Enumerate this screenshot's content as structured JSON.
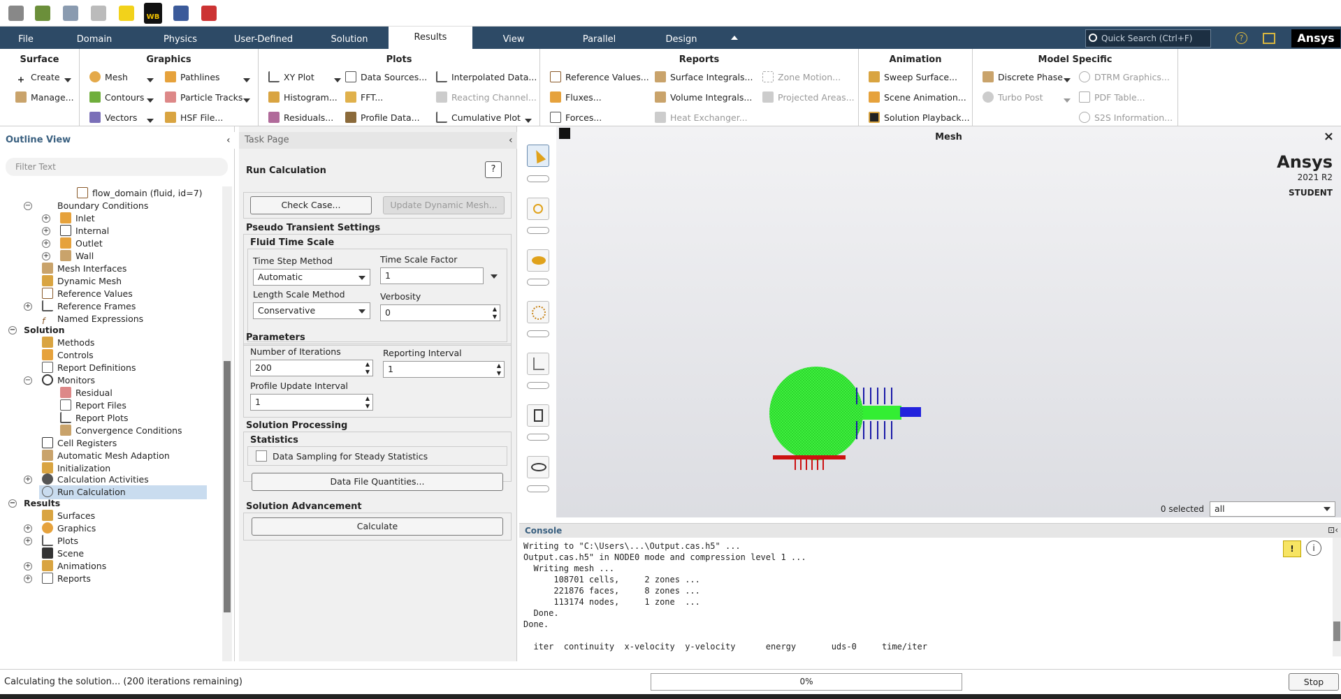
{
  "toolbar_quick_access": [
    "new-file-icon",
    "open-icon",
    "save-icon",
    "reload-icon",
    "power-icon",
    "workbench-icon",
    "parallel-icon",
    "units-icon"
  ],
  "workbench_label": "WB",
  "menu": {
    "tabs": [
      "File",
      "Domain",
      "Physics",
      "User-Defined",
      "Solution",
      "Results",
      "View",
      "Parallel",
      "Design"
    ],
    "active": "Results",
    "search_placeholder": "Quick Search (Ctrl+F)",
    "brand": "Ansys"
  },
  "ribbon": {
    "surface": {
      "title": "Surface",
      "items": [
        "Create",
        "Manage..."
      ]
    },
    "graphics": {
      "title": "Graphics",
      "items": [
        "Mesh",
        "Contours",
        "Vectors",
        "Pathlines",
        "Particle Tracks",
        "HSF File..."
      ]
    },
    "plots": {
      "title": "Plots",
      "items": [
        "XY Plot",
        "Histogram...",
        "Residuals...",
        "Data Sources...",
        "FFT...",
        "Profile Data...",
        "Interpolated Data...",
        "Reacting Channel...",
        "Cumulative Plot"
      ]
    },
    "reports": {
      "title": "Reports",
      "items": [
        "Reference Values...",
        "Fluxes...",
        "Forces...",
        "Surface Integrals...",
        "Volume Integrals...",
        "Heat Exchanger...",
        "Zone Motion...",
        "Projected Areas..."
      ]
    },
    "animation": {
      "title": "Animation",
      "items": [
        "Sweep Surface...",
        "Scene Animation...",
        "Solution Playback..."
      ]
    },
    "model_specific": {
      "title": "Model Specific",
      "items": [
        "Discrete Phase",
        "Turbo Post",
        "DTRM Graphics...",
        "PDF Table...",
        "S2S Information..."
      ]
    }
  },
  "outline": {
    "title": "Outline View",
    "filter_placeholder": "Filter Text",
    "nodes": [
      "flow_domain (fluid, id=7)",
      "Boundary Conditions",
      "Inlet",
      "Internal",
      "Outlet",
      "Wall",
      "Mesh Interfaces",
      "Dynamic Mesh",
      "Reference Values",
      "Reference Frames",
      "Named Expressions",
      "Solution",
      "Methods",
      "Controls",
      "Report Definitions",
      "Monitors",
      "Residual",
      "Report Files",
      "Report Plots",
      "Convergence Conditions",
      "Cell Registers",
      "Automatic Mesh Adaption",
      "Initialization",
      "Calculation Activities",
      "Run Calculation",
      "Results",
      "Surfaces",
      "Graphics",
      "Plots",
      "Scene",
      "Animations",
      "Reports"
    ]
  },
  "task": {
    "title": "Task Page",
    "heading": "Run Calculation",
    "help": "?",
    "check_case": "Check Case...",
    "update_mesh": "Update Dynamic Mesh...",
    "pseudo": "Pseudo Transient Settings",
    "fluid_time_scale": "Fluid Time Scale",
    "time_step_method_label": "Time Step Method",
    "time_step_method": "Automatic",
    "time_scale_factor_label": "Time Scale Factor",
    "time_scale_factor": "1",
    "length_scale_method_label": "Length Scale Method",
    "length_scale_method": "Conservative",
    "verbosity_label": "Verbosity",
    "verbosity": "0",
    "parameters": "Parameters",
    "iterations_label": "Number of Iterations",
    "iterations": "200",
    "reporting_label": "Reporting Interval",
    "reporting": "1",
    "profile_label": "Profile Update Interval",
    "profile": "1",
    "solution_processing": "Solution Processing",
    "statistics": "Statistics",
    "data_sampling": "Data Sampling for Steady Statistics",
    "data_file_quantities": "Data File Quantities...",
    "solution_advancement": "Solution Advancement",
    "calculate": "Calculate"
  },
  "viewport": {
    "title": "Mesh",
    "logo": "Ansys",
    "version": "2021 R2",
    "edition": "STUDENT",
    "selected": "0 selected",
    "filter": "all"
  },
  "console": {
    "title": "Console",
    "lines": [
      "Writing to \"C:\\Users\\...\\Output.cas.h5\" ...",
      "Output.cas.h5\" in NODE0 mode and compression level 1 ...",
      "  Writing mesh ...",
      "      108701 cells,     2 zones ...",
      "      221876 faces,     8 zones ...",
      "      113174 nodes,     1 zone  ...",
      "  Done.",
      "Done.",
      "",
      "  iter  continuity  x-velocity  y-velocity      energy       uds-0     time/iter"
    ]
  },
  "status": {
    "text": "Calculating the solution... (200 iterations remaining)",
    "progress": "0%",
    "progress_fraction": 0,
    "stop": "Stop"
  }
}
